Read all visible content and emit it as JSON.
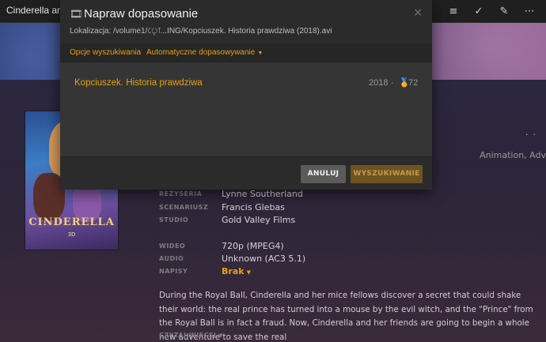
{
  "app": {
    "title": "Cinderella and",
    "top_icons": [
      "play-icon",
      "add-to-list-icon",
      "check-icon",
      "edit-icon",
      "more-icon"
    ]
  },
  "dialog": {
    "title": "Napraw dopasowanie",
    "path": "Lokalizacja: /volume1/ৃো...ING/Kopciuszek. Historia prawdziwa (2018).avi",
    "close_glyph": "×",
    "tabs": [
      {
        "label": "Opcje wyszukiwania"
      },
      {
        "label": "Automatyczne dopasowywanie"
      }
    ],
    "result": {
      "title": "Kopciuszek. Historia prawdziwa",
      "year": "2018",
      "separator": "·",
      "score": "72"
    },
    "cancel_label": "ANULUJ",
    "search_label": "WYSZUKIWANIE"
  },
  "movie": {
    "genre": "Animation, Adv",
    "poster_title": "CINDERELLA",
    "poster_sub": "3D",
    "director_label": "REŻYSERIA",
    "director": "Lynne Southerland",
    "writer_label": "SCENARIUSZ",
    "writer": "Francis Glebas",
    "studio_label": "STUDIO",
    "studio": "Gold Valley Films",
    "video_label": "WIDEO",
    "video": "720p (MPEG4)",
    "audio_label": "AUDIO",
    "audio": "Unknown (AC3 5.1)",
    "subs_label": "NAPISY",
    "subs": "Brak",
    "description": "During the Royal Ball, Cinderella and her mice fellows discover a secret that could shake their world: the real prince has turned into a mouse by the evil witch, and the \"Prince\" from the Royal Ball is in fact a fraud. Now, Cinderella and her friends are going to begin a whole new adventure to save the real",
    "read_more": "CZYTAJ WIĘCEJ"
  },
  "colors": {
    "accent": "#e5a00d",
    "modal_bg": "#353535",
    "modal_header": "#2b2b2b"
  }
}
